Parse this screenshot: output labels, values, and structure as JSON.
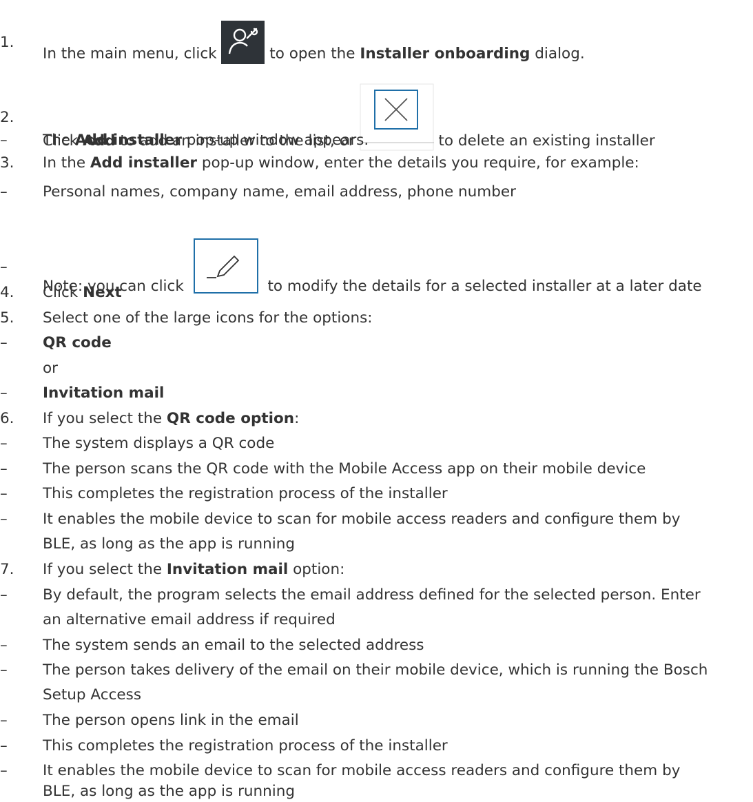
{
  "steps": [
    {
      "marker": "1.",
      "t1": "In the main menu, click ",
      "t2": " to open the ",
      "bold": "Installer onboarding",
      "t3": " dialog."
    },
    {
      "marker": "2.",
      "t1": "Click ",
      "bold": "Add",
      "t2": " to add an installer to the list, or ",
      "t3": " to delete an existing installer"
    },
    {
      "marker": "–",
      "t1": "The ",
      "bold": "Add installer",
      "t2": " pop-up window appears."
    },
    {
      "marker": "3.",
      "t1": "In the ",
      "bold": "Add installer",
      "t2": " pop-up window, enter the details you require, for example:"
    },
    {
      "marker": "–",
      "text": "Personal names, company name, email address, phone number"
    },
    {
      "marker": "–",
      "t1": "Note: you can click ",
      "t2": " to modify the details for a selected installer at a later date"
    },
    {
      "marker": "4.",
      "t1": "Click ",
      "bold": "Next"
    },
    {
      "marker": "5.",
      "text": "Select one of the large icons for the options:"
    },
    {
      "marker": "–",
      "bold": "QR code"
    },
    {
      "text": "or"
    },
    {
      "marker": "–",
      "bold": "Invitation mail"
    },
    {
      "marker": "6.",
      "t1": "If you select the ",
      "bold": "QR code option",
      "t2": ":"
    },
    {
      "marker": "–",
      "text": "The system displays a QR code"
    },
    {
      "marker": "–",
      "text": "The person scans the QR code with the Mobile Access app on their mobile device"
    },
    {
      "marker": "–",
      "text": "This completes the registration process of the installer"
    },
    {
      "marker": "–",
      "text": "It enables the mobile device to scan for mobile access readers and configure them by",
      "text2": "BLE, as long as the app is running"
    },
    {
      "marker": "7.",
      "t1": "If you select the ",
      "bold": "Invitation mail",
      "t2": " option:"
    },
    {
      "marker": "–",
      "text": "By default, the program selects the email address defined for the selected person. Enter",
      "text2": "an alternative email address if required"
    },
    {
      "marker": "–",
      "text": "The system sends an email to the selected address"
    },
    {
      "marker": "–",
      "text": "The person takes delivery of the email on their mobile device, which is running the Bosch",
      "text2": "Setup Access"
    },
    {
      "marker": "–",
      "text": "The person opens link in the email"
    },
    {
      "marker": "–",
      "text": "This completes the registration process of the installer"
    },
    {
      "marker": "–",
      "text": "It enables the mobile device to scan for mobile access readers and configure them by",
      "text2": "BLE, as long as the app is running"
    }
  ],
  "icons": {
    "installer_icon": "user-wrench-icon",
    "delete_icon": "close-icon",
    "edit_icon": "pencil-icon",
    "colors": {
      "dark_tile": "#2e3338",
      "accent_blue": "#1f6fa8",
      "text": "#333333"
    }
  }
}
